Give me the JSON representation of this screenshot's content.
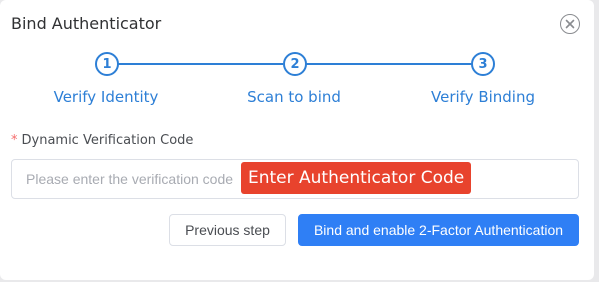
{
  "dialog": {
    "title": "Bind Authenticator",
    "close_icon": "close-circle-icon"
  },
  "steps": [
    {
      "number": "1",
      "label": "Verify Identity"
    },
    {
      "number": "2",
      "label": "Scan to bind"
    },
    {
      "number": "3",
      "label": "Verify Binding"
    }
  ],
  "form": {
    "required_marker": "*",
    "label": "Dynamic Verification Code",
    "input_value": "",
    "input_placeholder": "Please enter the verification code",
    "overlay_hint": "Enter Authenticator Code"
  },
  "buttons": {
    "previous": "Previous step",
    "primary": "Bind and enable 2-Factor Authentication"
  },
  "colors": {
    "accent": "#2d7fd6",
    "primary_button": "#2f7ff5",
    "required": "#f56c6c",
    "overlay_hint_bg": "#e8432d"
  }
}
